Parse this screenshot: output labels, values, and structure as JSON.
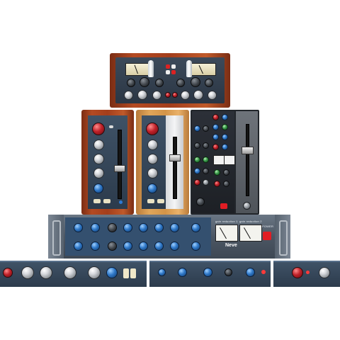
{
  "channel_strip_large": {
    "brand": "Neve",
    "meter_left": "gain reduction 1",
    "meter_right": "gain reduction 2",
    "power_label": "POWER"
  },
  "colors": {
    "wood_dark": "#a33e1c",
    "wood_light": "#d39448",
    "panel_navy": "#2c3b4c",
    "rack_grey": "#4b5663",
    "power_red": "#e11d24"
  }
}
